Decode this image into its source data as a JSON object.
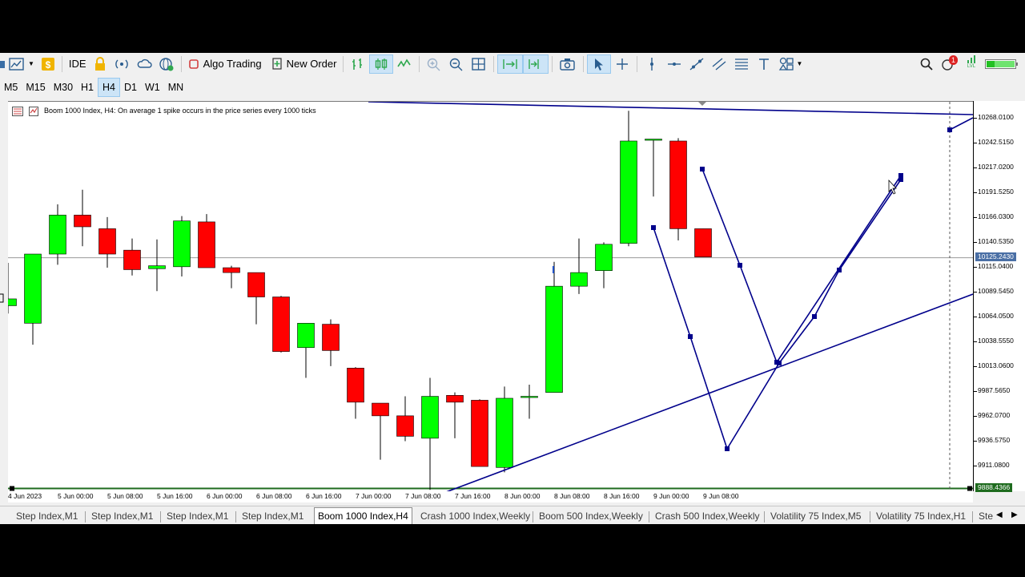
{
  "toolbar": {
    "ide_label": "IDE",
    "algo_trading_label": "Algo Trading",
    "new_order_label": "New Order",
    "notification_count": "1",
    "lvl_label": "LVL"
  },
  "timeframes": [
    "M5",
    "M15",
    "M30",
    "H1",
    "H4",
    "D1",
    "W1",
    "MN"
  ],
  "active_timeframe": "H4",
  "chart": {
    "title": "Boom 1000 Index, H4:  On average 1 spike occurs in the price series every 1000 ticks",
    "price_ticks": [
      "10268.0100",
      "10242.5150",
      "10217.0200",
      "10191.5250",
      "10166.0300",
      "10140.5350",
      "10115.0400",
      "10089.5450",
      "10064.0500",
      "10038.5550",
      "10013.0600",
      "9987.5650",
      "9962.0700",
      "9936.5750",
      "9911.0800"
    ],
    "current_price": "10125.2430",
    "low_price_label": "9888.4366",
    "time_ticks": [
      "4 Jun 2023",
      "5 Jun 00:00",
      "5 Jun 08:00",
      "5 Jun 16:00",
      "6 Jun 00:00",
      "6 Jun 08:00",
      "6 Jun 16:00",
      "7 Jun 00:00",
      "7 Jun 08:00",
      "7 Jun 16:00",
      "8 Jun 00:00",
      "8 Jun 08:00",
      "8 Jun 16:00",
      "9 Jun 00:00",
      "9 Jun 08:00"
    ],
    "colors": {
      "bull": "#00ff00",
      "bear": "#ff0000",
      "lines": "#00008b",
      "bid_badge": "#4a6fa5",
      "low_badge": "#1e6b1e"
    }
  },
  "chart_data": {
    "type": "candlestick",
    "symbol": "Boom 1000 Index",
    "timeframe": "H4",
    "candles": [
      {
        "o": 10076,
        "h": 10120,
        "l": 10068,
        "c": 10083
      },
      {
        "o": 10058,
        "h": 10114,
        "l": 10036,
        "c": 10129
      },
      {
        "o": 10129,
        "h": 10180,
        "l": 10118,
        "c": 10169
      },
      {
        "o": 10169,
        "h": 10195,
        "l": 10137,
        "c": 10157
      },
      {
        "o": 10155,
        "h": 10167,
        "l": 10115,
        "c": 10129
      },
      {
        "o": 10133,
        "h": 10145,
        "l": 10107,
        "c": 10113
      },
      {
        "o": 10114,
        "h": 10144,
        "l": 10091,
        "c": 10117
      },
      {
        "o": 10116,
        "h": 10168,
        "l": 10106,
        "c": 10163
      },
      {
        "o": 10162,
        "h": 10170,
        "l": 10115,
        "c": 10115
      },
      {
        "o": 10115,
        "h": 10117,
        "l": 10094,
        "c": 10110
      },
      {
        "o": 10110,
        "h": 10110,
        "l": 10057,
        "c": 10085
      },
      {
        "o": 10085,
        "h": 10086,
        "l": 10028,
        "c": 10029
      },
      {
        "o": 10033,
        "h": 10047,
        "l": 10002,
        "c": 10058
      },
      {
        "o": 10057,
        "h": 10062,
        "l": 10014,
        "c": 10030
      },
      {
        "o": 10012,
        "h": 10013,
        "l": 9960,
        "c": 9977
      },
      {
        "o": 9976,
        "h": 9976,
        "l": 9918,
        "c": 9963
      },
      {
        "o": 9963,
        "h": 9983,
        "l": 9937,
        "c": 9942
      },
      {
        "o": 9940,
        "h": 10002,
        "l": 9887,
        "c": 9983
      },
      {
        "o": 9984,
        "h": 9987,
        "l": 9940,
        "c": 9977
      },
      {
        "o": 9979,
        "h": 9980,
        "l": 9911,
        "c": 9911
      },
      {
        "o": 9910,
        "h": 9993,
        "l": 9905,
        "c": 9981
      },
      {
        "o": 9983,
        "h": 9995,
        "l": 9960,
        "c": 9983
      },
      {
        "o": 9987,
        "h": 10121,
        "l": 9987,
        "c": 10096
      },
      {
        "o": 10096,
        "h": 10145,
        "l": 10088,
        "c": 10110
      },
      {
        "o": 10112,
        "h": 10141,
        "l": 10094,
        "c": 10139
      },
      {
        "o": 10140,
        "h": 10276,
        "l": 10137,
        "c": 10245
      },
      {
        "o": 10247,
        "h": 10247,
        "l": 10188,
        "c": 10247
      },
      {
        "o": 10245,
        "h": 10248,
        "l": 10143,
        "c": 10155
      },
      {
        "o": 10155,
        "h": 10155,
        "l": 10126,
        "c": 10126
      }
    ]
  }
}
